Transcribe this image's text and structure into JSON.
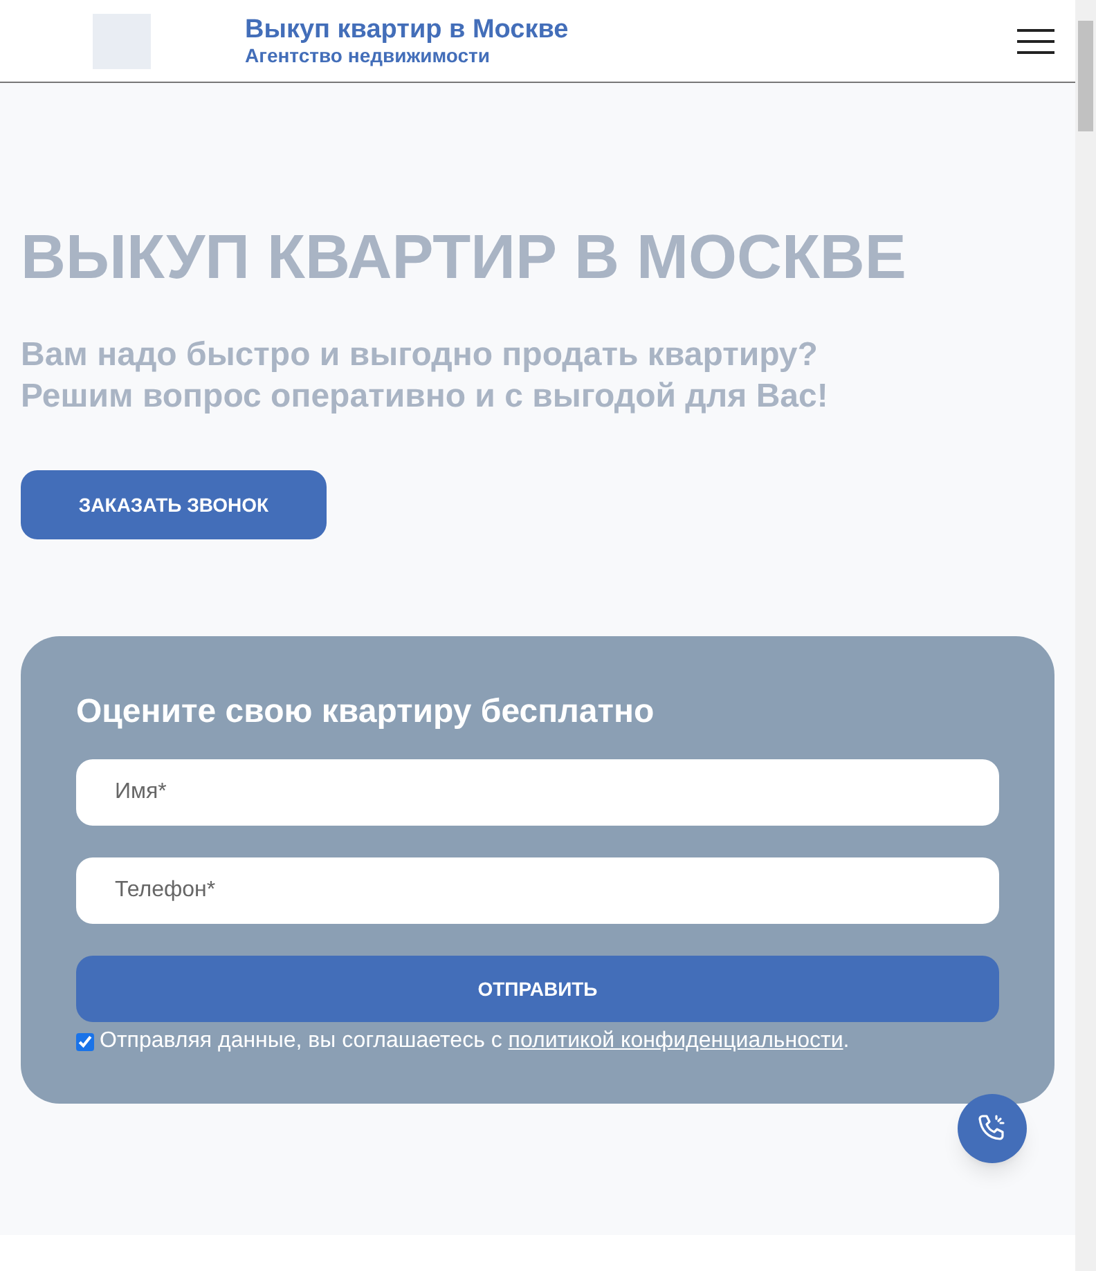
{
  "header": {
    "title": "Выкуп квартир в Москве",
    "subtitle": "Агентство недвижимости"
  },
  "hero": {
    "heading": "ВЫКУП КВАРТИР В МОСКВЕ",
    "lines": [
      "Вам надо быстро и выгодно продать квартиру?",
      "Решим вопрос оперативно и с выгодой для Вас!"
    ],
    "button": "ЗАКАЗАТЬ ЗВОНОК"
  },
  "form": {
    "title": "Оцените свою квартиру бесплатно",
    "fields": [
      {
        "placeholder": "Имя*"
      },
      {
        "placeholder": "Телефон*"
      }
    ],
    "submit": "ОТПРАВИТЬ",
    "consent": {
      "checked": true,
      "text": "Отправляя данные, вы соглашаетесь с ",
      "link": "политикой конфиденциальности",
      "after": "."
    }
  }
}
